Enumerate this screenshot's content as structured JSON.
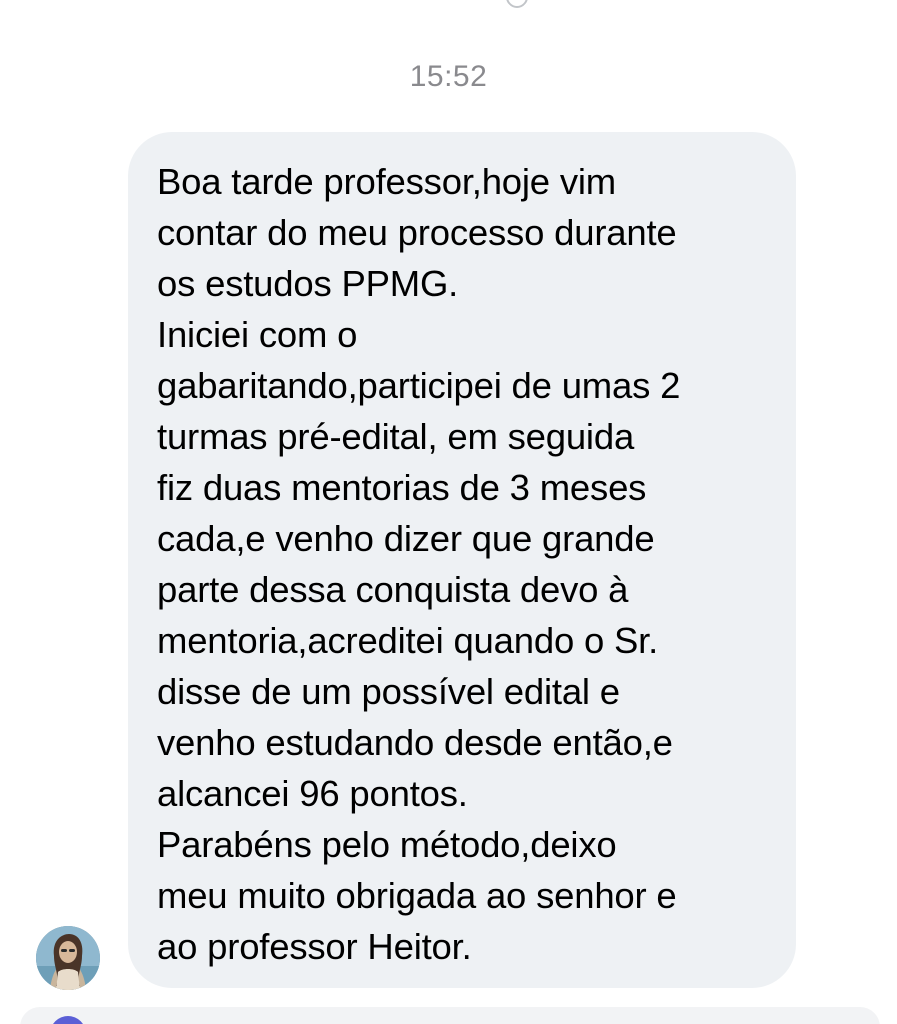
{
  "timestamp": "15:52",
  "message": {
    "paragraphs": [
      {
        "lines": [
          "Boa tarde professor,hoje vim",
          "contar do meu processo durante",
          "os estudos PPMG."
        ]
      },
      {
        "lines": [
          "Iniciei com o",
          "gabaritando,participei de umas 2",
          "turmas pré-edital, em seguida",
          "fiz duas mentorias de 3 meses",
          "cada,e venho dizer que grande",
          "parte dessa conquista devo à",
          "mentoria,acreditei quando o Sr.",
          "disse de um possível edital e",
          "venho estudando desde então,e",
          "alcancei 96 pontos."
        ]
      },
      {
        "lines": [
          "Parabéns pelo método,deixo",
          "meu muito obrigada ao senhor e",
          "ao professor Heitor."
        ]
      }
    ]
  },
  "sender": {
    "avatar_icon": "profile-photo-avatar"
  },
  "colors": {
    "bubble": "#eef1f4",
    "timestamp": "#8a8a8e",
    "text": "#000000",
    "accent": "#5b5fd6"
  }
}
